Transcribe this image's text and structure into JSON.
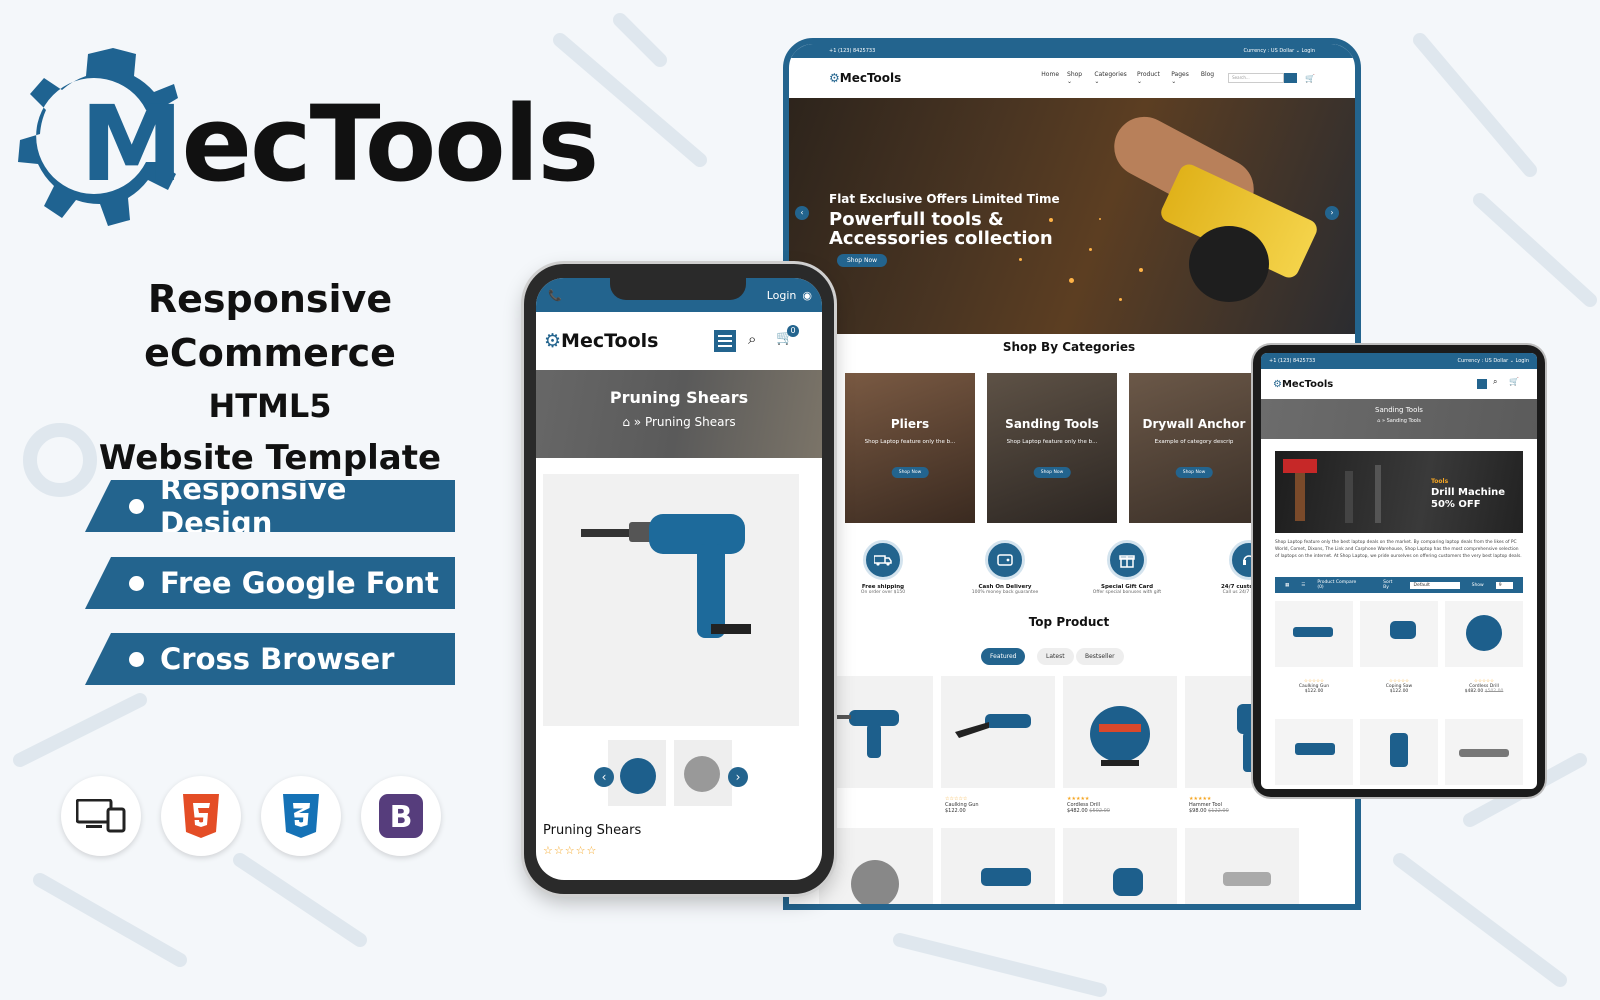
{
  "brand": {
    "logo_m": "M",
    "logo_rest": "ecTools",
    "primary_color": "#23648e",
    "accent_color": "#f5a623"
  },
  "headline": {
    "line1": "Responsive eCommerce",
    "line2": "HTML5",
    "line3": "Website Template"
  },
  "features": [
    "Responsive Design",
    "Free Google Font",
    "Cross Browser"
  ],
  "tech_icons": [
    "responsive-devices-icon",
    "html5-icon",
    "css3-icon",
    "bootstrap-icon"
  ],
  "desktop": {
    "topbar_phone": "+1 (123) 8425733",
    "topbar_right": "Currency : US Dollar ⌄   Login",
    "logo": "MecTools",
    "menu": [
      "Home",
      "Shop ⌄",
      "Categories ⌄",
      "Product ⌄",
      "Pages ⌄",
      "Blog"
    ],
    "search_placeholder": "Search...",
    "hero": {
      "subtitle": "Flat Exclusive Offers Limited Time",
      "title_line1": "Powerfull tools &",
      "title_line2": "Accessories collection",
      "cta": "Shop Now"
    },
    "categories_title": "Shop By Categories",
    "categories": [
      {
        "name": "Pliers",
        "desc": "Shop Laptop feature only the b...",
        "cta": "Shop Now"
      },
      {
        "name": "Sanding Tools",
        "desc": "Shop Laptop feature only the b...",
        "cta": "Shop Now"
      },
      {
        "name": "Drywall Anchor",
        "desc": "Example of category descrip",
        "cta": "Shop Now"
      }
    ],
    "services": [
      {
        "title": "Free shipping",
        "sub": "On order over $150"
      },
      {
        "title": "Cash On Delivery",
        "sub": "100% money back guarantee"
      },
      {
        "title": "Special Gift Card",
        "sub": "Offer special bonuses with gift"
      },
      {
        "title": "24/7 customer ser",
        "sub": "Call us 24/7 at 123-456"
      }
    ],
    "top_product_title": "Top Product",
    "tabs": [
      "Featured",
      "Latest",
      "Bestseller"
    ],
    "products": [
      {
        "name": "s Tool",
        "price": ""
      },
      {
        "name": "Caulking Gun",
        "price": "$122.00"
      },
      {
        "name": "Cordless Drill",
        "price": "$482.00",
        "old_price": "$502.00"
      },
      {
        "name": "Hammer Tool",
        "price": "$98.00",
        "old_price": "$122.00"
      }
    ]
  },
  "phone": {
    "login": "Login",
    "logo": "MecTools",
    "cart_count": "0",
    "page_title": "Pruning Shears",
    "breadcrumb_current": "Pruning Shears",
    "product_name": "Pruning Shears",
    "stars": "☆☆☆☆☆"
  },
  "tablet": {
    "topbar_phone": "+1 (123) 8425733",
    "topbar_right": "Currency : US Dollar ⌄   Login",
    "logo": "MecTools",
    "page_title": "Sanding Tools",
    "breadcrumb_current": "Sanding Tools",
    "banner_kicker": "Tools",
    "banner_line1": "Drill Machine",
    "banner_line2": "50% OFF",
    "description": "Shop Laptop feature only the best laptop deals on the market. By comparing laptop deals from the likes of PC World, Comet, Dixons, The Link and Carphone Warehouse, Shop Laptop has the most comprehensive selection of laptops on the internet. At Shop Laptop, we pride ourselves on offering customers the very best laptop deals.",
    "toolbar": {
      "compare": "Product Compare (0)",
      "sort_label": "Sort By",
      "sort_value": "Default",
      "show_label": "Show",
      "show_value": "9"
    },
    "products": [
      {
        "name": "Caulking Gun",
        "price": "$122.00"
      },
      {
        "name": "Coping Saw",
        "price": "$122.00"
      },
      {
        "name": "Cordless Drill",
        "price": "$482.00",
        "old_price": "$502.00"
      }
    ]
  }
}
